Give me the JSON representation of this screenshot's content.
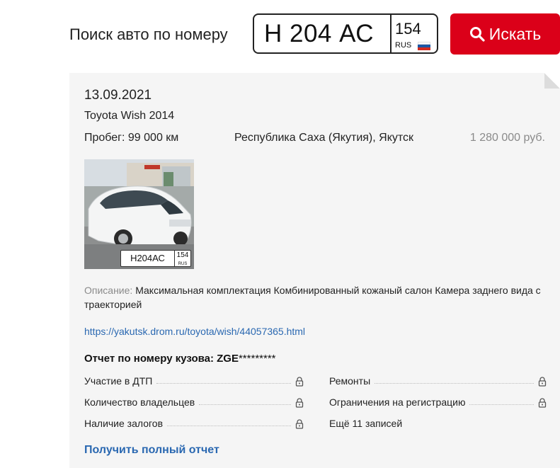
{
  "search": {
    "label": "Поиск авто по номеру",
    "plate_number": "Н 204 АС",
    "plate_region": "154",
    "plate_country": "RUS",
    "button_label": "Искать",
    "button_color": "#db0019"
  },
  "listing": {
    "date": "13.09.2021",
    "model": "Toyota Wish 2014",
    "mileage": "Пробег: 99 000 км",
    "location": "Республика Саха (Якутия), Якутск",
    "price": "1 280 000 руб.",
    "photo_plate_number": "Н204АС",
    "photo_plate_region": "154",
    "photo_plate_country": "RUS",
    "description_label": "Описание:",
    "description": "Максимальная комплектация Комбинированный кожаный салон Камера заднего вида с траекторией",
    "url": "https://yakutsk.drom.ru/toyota/wish/44057365.html"
  },
  "report": {
    "title": "Отчет по номеру кузова: ZGE",
    "mask": "*********",
    "items_left": [
      "Участие в ДТП",
      "Количество владельцев",
      "Наличие залогов"
    ],
    "items_right": [
      "Ремонты",
      "Ограничения на регистрацию"
    ],
    "more": "Ещё 11 записей",
    "cta": "Получить полный отчет"
  },
  "colors": {
    "link": "#2a68b1",
    "muted": "#8a8a8a",
    "card_bg": "#f5f5f5"
  }
}
